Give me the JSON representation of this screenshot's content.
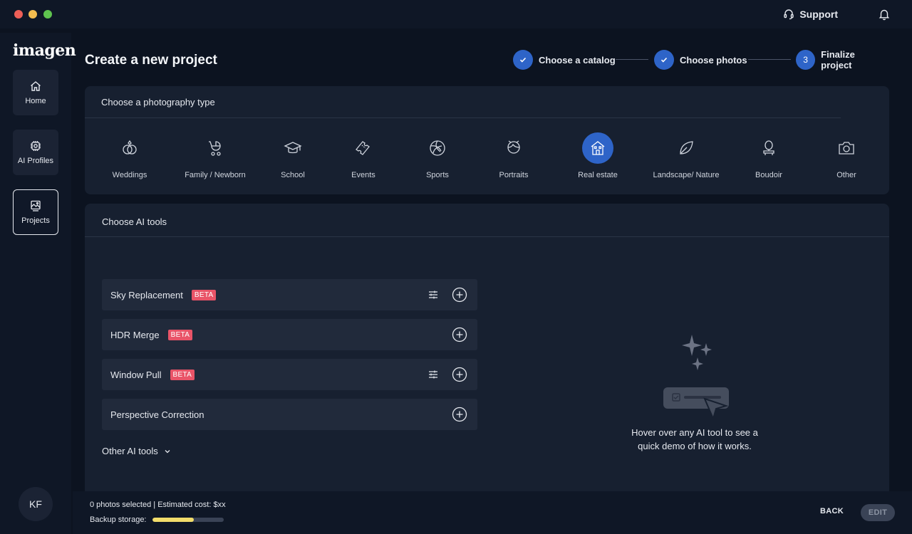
{
  "app": {
    "logo": "imagen",
    "support_label": "Support",
    "user_initials": "KF"
  },
  "nav": {
    "items": [
      {
        "label": "Home",
        "icon": "home-icon"
      },
      {
        "label": "AI Profiles",
        "icon": "ai-chip-icon"
      },
      {
        "label": "Projects",
        "icon": "projects-icon",
        "active": true
      }
    ]
  },
  "page": {
    "title": "Create a new project"
  },
  "stepper": {
    "steps": [
      {
        "label": "Choose a catalog",
        "state": "done"
      },
      {
        "label": "Choose photos",
        "state": "done"
      },
      {
        "label": "Finalize project",
        "state": "current",
        "number": "3"
      }
    ]
  },
  "photography": {
    "title": "Choose a photography type",
    "selected": "Real estate",
    "types": [
      {
        "label": "Weddings",
        "icon": "rings-icon"
      },
      {
        "label": "Family / Newborn",
        "icon": "stroller-icon"
      },
      {
        "label": "School",
        "icon": "graduation-cap-icon"
      },
      {
        "label": "Events",
        "icon": "ticket-icon"
      },
      {
        "label": "Sports",
        "icon": "ball-icon"
      },
      {
        "label": "Portraits",
        "icon": "face-icon"
      },
      {
        "label": "Real estate",
        "icon": "house-icon"
      },
      {
        "label": "Landscape/ Nature",
        "icon": "leaf-icon"
      },
      {
        "label": "Boudoir",
        "icon": "mirror-icon"
      },
      {
        "label": "Other",
        "icon": "camera-icon"
      }
    ]
  },
  "ai_tools": {
    "title": "Choose AI tools",
    "beta_label": "BETA",
    "tools": [
      {
        "name": "Sky Replacement",
        "beta": true,
        "settings": true
      },
      {
        "name": "HDR Merge",
        "beta": true,
        "settings": false
      },
      {
        "name": "Window Pull",
        "beta": true,
        "settings": true
      },
      {
        "name": "Perspective Correction",
        "beta": false,
        "settings": false
      }
    ],
    "other_tools_label": "Other AI tools",
    "demo_hint": "Hover over any AI tool to see a quick demo of how it works."
  },
  "footer": {
    "selection_text": "0 photos selected | Estimated cost: $xx",
    "backup_label": "Backup storage:",
    "backup_fraction": 0.58,
    "back_label": "BACK",
    "edit_label": "EDIT"
  },
  "colors": {
    "accent": "#2e64c8",
    "beta": "#e95468",
    "storage": "#f2dd6b"
  }
}
